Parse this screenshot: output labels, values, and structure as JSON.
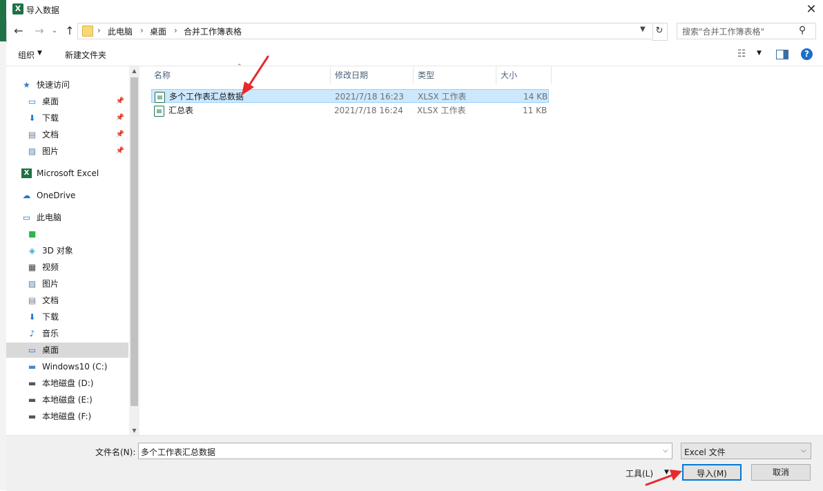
{
  "window": {
    "title": "导入数据",
    "app_icon_text": "X"
  },
  "address": {
    "crumbs": [
      "此电脑",
      "桌面",
      "合并工作簿表格"
    ],
    "search_placeholder": "搜索\"合并工作簿表格\""
  },
  "toolbar": {
    "organize_label": "组织",
    "new_folder_label": "新建文件夹"
  },
  "nav": {
    "items": [
      {
        "label": "快速访问",
        "icon": "star-icon"
      },
      {
        "label": "桌面",
        "icon": "desktop-icon",
        "pinned": true
      },
      {
        "label": "下载",
        "icon": "download-icon",
        "pinned": true
      },
      {
        "label": "文档",
        "icon": "document-icon",
        "pinned": true
      },
      {
        "label": "图片",
        "icon": "picture-icon",
        "pinned": true
      },
      {
        "label": "Microsoft Excel",
        "icon": "excel-icon"
      },
      {
        "label": "OneDrive",
        "icon": "cloud-icon"
      },
      {
        "label": "此电脑",
        "icon": "computer-icon"
      },
      {
        "label": "",
        "icon": "green-app-icon"
      },
      {
        "label": "3D 对象",
        "icon": "cube-icon"
      },
      {
        "label": "视频",
        "icon": "video-icon"
      },
      {
        "label": "图片",
        "icon": "picture-icon"
      },
      {
        "label": "文档",
        "icon": "document-icon"
      },
      {
        "label": "下载",
        "icon": "download-icon"
      },
      {
        "label": "音乐",
        "icon": "music-icon"
      },
      {
        "label": "桌面",
        "icon": "desktop-icon",
        "selected": true
      },
      {
        "label": "Windows10 (C:)",
        "icon": "drive-c-icon"
      },
      {
        "label": "本地磁盘 (D:)",
        "icon": "drive-icon"
      },
      {
        "label": "本地磁盘 (E:)",
        "icon": "drive-icon"
      },
      {
        "label": "本地磁盘 (F:)",
        "icon": "drive-icon"
      }
    ]
  },
  "files": {
    "columns": [
      "名称",
      "修改日期",
      "类型",
      "大小"
    ],
    "rows": [
      {
        "name": "多个工作表汇总数据",
        "date": "2021/7/18 16:23",
        "type": "XLSX 工作表",
        "size": "14 KB",
        "selected": true
      },
      {
        "name": "汇总表",
        "date": "2021/7/18 16:24",
        "type": "XLSX 工作表",
        "size": "11 KB"
      }
    ]
  },
  "footer": {
    "filename_label": "文件名(N):",
    "filename_value": "多个工作表汇总数据",
    "filetype_value": "Excel 文件",
    "tools_label": "工具(L)",
    "import_label": "导入(M)",
    "cancel_label": "取消"
  },
  "colors": {
    "accent": "#0078d7",
    "selection": "#cce8ff",
    "excel_green": "#1e7145",
    "annotation_red": "#e8282b"
  }
}
